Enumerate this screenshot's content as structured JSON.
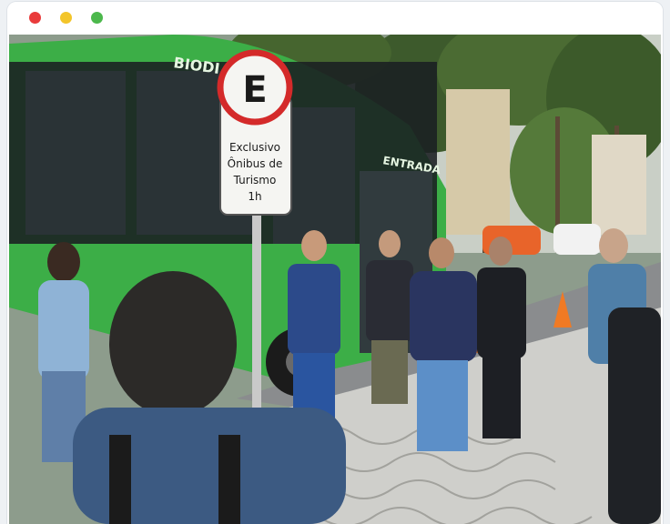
{
  "window": {
    "controls": [
      {
        "name": "close",
        "color": "#e93b3b"
      },
      {
        "name": "minimize",
        "color": "#f3c52a"
      },
      {
        "name": "maximize",
        "color": "#4cb84c"
      }
    ]
  },
  "photo": {
    "bus": {
      "brand_text": "BIODI",
      "door_text": "ENTRADA",
      "color": "#3cae47"
    },
    "sign": {
      "letter": "E",
      "line1": "Exclusivo",
      "line2": "Ônibus de",
      "line3": "Turismo",
      "line4": "1h",
      "ring_color": "#d42a2a"
    }
  }
}
